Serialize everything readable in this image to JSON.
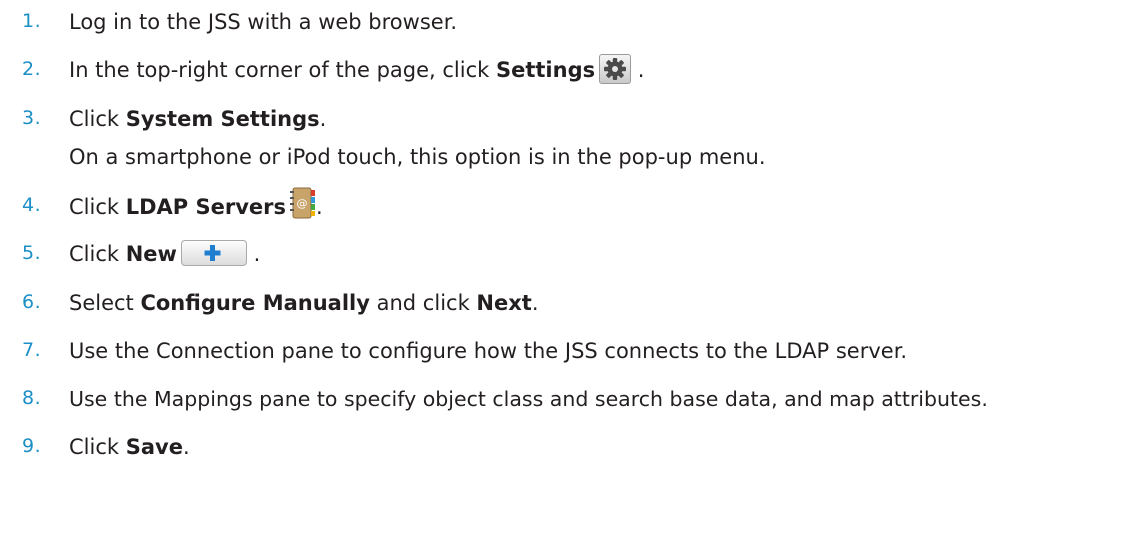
{
  "steps": [
    {
      "num": "1.",
      "before": "Log in to the JSS with a web browser.",
      "bold": "",
      "after": ""
    },
    {
      "num": "2.",
      "before": "In the top-right corner of the page, click ",
      "bold": "Settings",
      "icon": "gear-icon",
      "after": " ."
    },
    {
      "num": "3.",
      "before": "Click ",
      "bold": "System Settings",
      "after": ".",
      "note": "On a smartphone or iPod touch, this option is in the pop-up menu."
    },
    {
      "num": "4.",
      "before": "Click ",
      "bold": "LDAP Servers",
      "icon": "address-book-icon",
      "after": "."
    },
    {
      "num": "5.",
      "before": "Click ",
      "bold": "New",
      "icon": "plus-icon",
      "after": " ."
    },
    {
      "num": "6.",
      "before": "Select ",
      "bold": "Configure Manually",
      "mid": " and click ",
      "bold2": "Next",
      "after": "."
    },
    {
      "num": "7.",
      "before": "Use the Connection pane to configure how the JSS connects to the LDAP server.",
      "bold": "",
      "after": ""
    },
    {
      "num": "8.",
      "before": "Use the Mappings pane to specify object class and search base data, and map attributes.",
      "bold": "",
      "after": ""
    },
    {
      "num": "9.",
      "before": "Click ",
      "bold": "Save",
      "after": "."
    }
  ],
  "colors": {
    "number": "#1b8fc6",
    "text": "#231f20",
    "plus": "#1e7fd0"
  }
}
